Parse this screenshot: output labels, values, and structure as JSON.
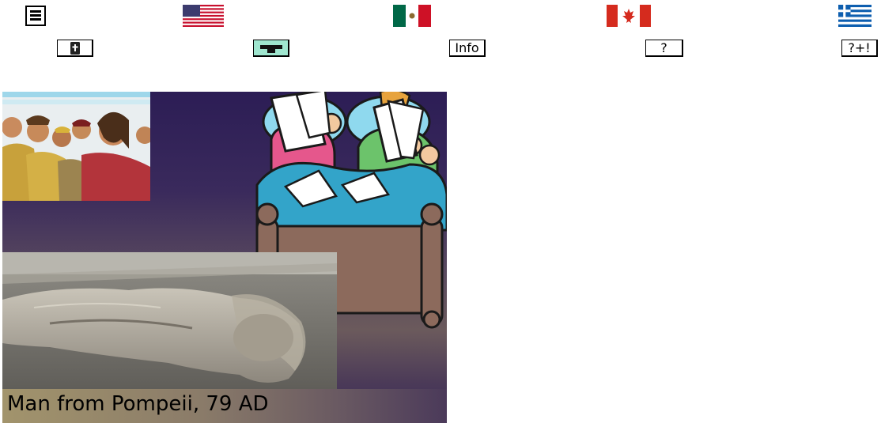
{
  "toolbar": {
    "menu_icon": "hamburger-menu-icon",
    "flags": [
      {
        "name": "us-flag-icon",
        "country": "United States"
      },
      {
        "name": "mexico-flag-icon",
        "country": "Mexico"
      },
      {
        "name": "canada-flag-icon",
        "country": "Canada"
      },
      {
        "name": "greece-flag-icon",
        "country": "Greece"
      }
    ]
  },
  "buttons": {
    "bible_icon": "bible-book-icon",
    "teacher_icon": "teacher-desk-icon",
    "info_label": "Info",
    "help_label": "?",
    "help_plus_label": "?+!"
  },
  "stage": {
    "caption": "Man from Pompeii, 79 AD",
    "images": [
      "jesus-disciples-illustration",
      "couple-reading-in-bed-cartoon",
      "pompeii-body-cast-photo"
    ]
  },
  "colors": {
    "stage_background": "#2c1d55",
    "flag_red": "#d52b1e",
    "flag_blue": "#1a3a8f",
    "mexico_green": "#006847",
    "greece_blue": "#0d5eaf"
  }
}
